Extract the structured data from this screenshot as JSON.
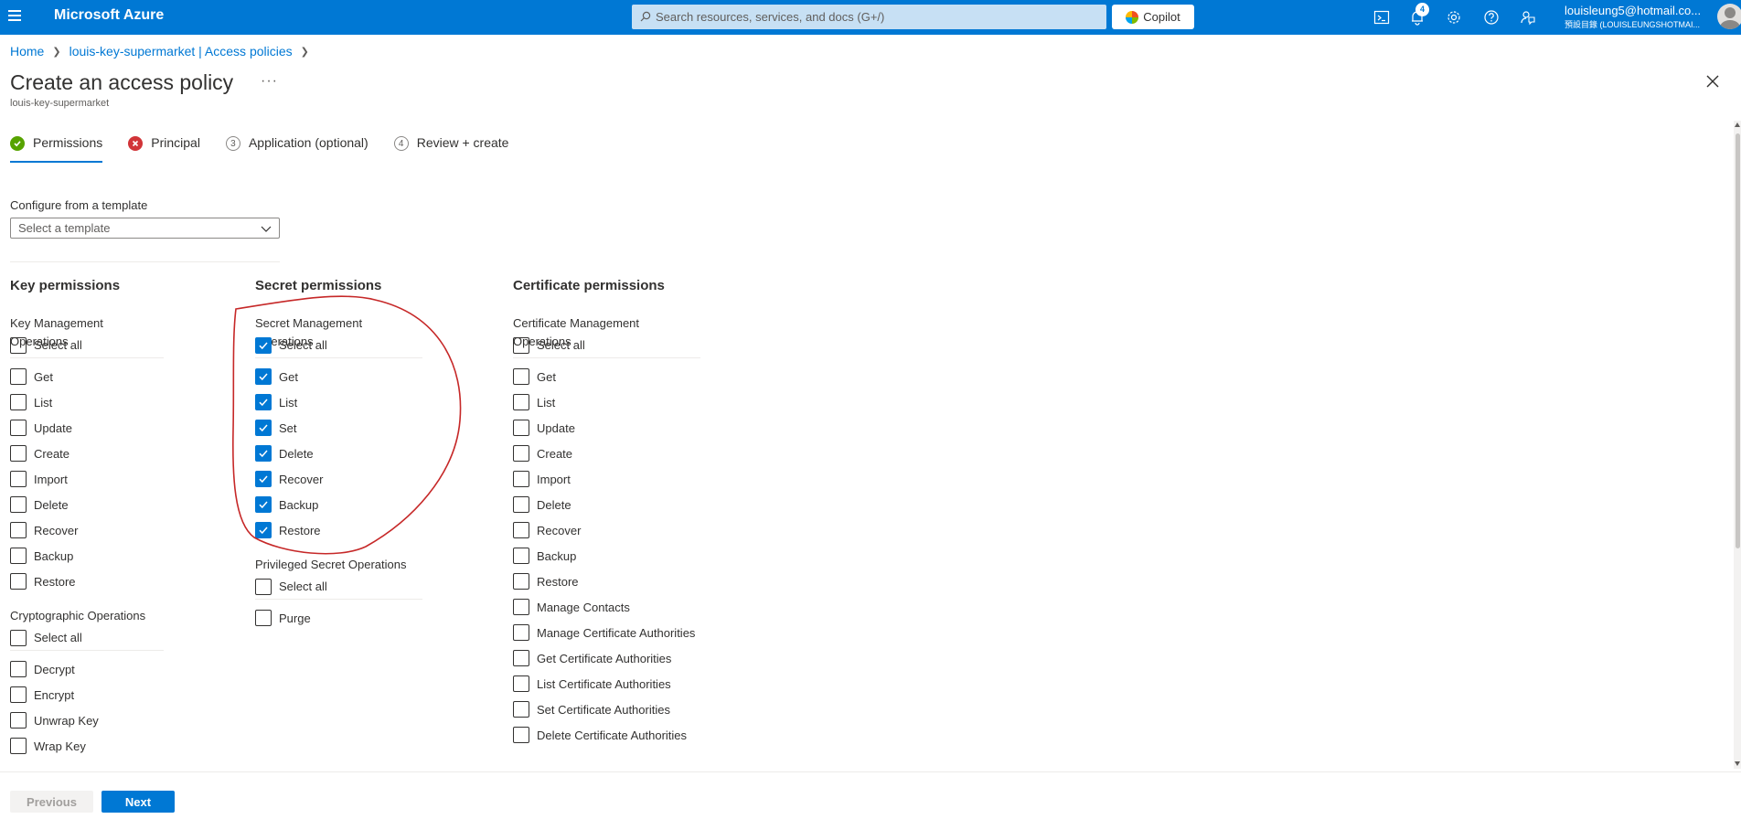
{
  "topbar": {
    "brand": "Microsoft Azure",
    "search_placeholder": "Search resources, services, and docs (G+/)",
    "copilot_label": "Copilot",
    "notification_count": "4",
    "account_email": "louisleung5@hotmail.co...",
    "account_directory": "預設目錄 (LOUISLEUNGSHOTMAI..."
  },
  "breadcrumb": {
    "home": "Home",
    "parent": "louis-key-supermarket | Access policies"
  },
  "page": {
    "title": "Create an access policy",
    "subtitle": "louis-key-supermarket",
    "more": "···"
  },
  "steps": [
    {
      "label": "Permissions",
      "state": "complete"
    },
    {
      "label": "Principal",
      "state": "error"
    },
    {
      "label": "Application (optional)",
      "number": "3"
    },
    {
      "label": "Review + create",
      "number": "4"
    }
  ],
  "template": {
    "label": "Configure from a template",
    "placeholder": "Select a template"
  },
  "key_permissions": {
    "title": "Key permissions",
    "management": {
      "title": "Key Management Operations",
      "select_all": "Select all",
      "items": [
        "Get",
        "List",
        "Update",
        "Create",
        "Import",
        "Delete",
        "Recover",
        "Backup",
        "Restore"
      ]
    },
    "crypto": {
      "title": "Cryptographic Operations",
      "select_all": "Select all",
      "items": [
        "Decrypt",
        "Encrypt",
        "Unwrap Key",
        "Wrap Key"
      ]
    }
  },
  "secret_permissions": {
    "title": "Secret permissions",
    "management": {
      "title": "Secret Management Operations",
      "select_all": "Select all",
      "select_all_checked": true,
      "items": [
        "Get",
        "List",
        "Set",
        "Delete",
        "Recover",
        "Backup",
        "Restore"
      ],
      "checked": true
    },
    "privileged": {
      "title": "Privileged Secret Operations",
      "select_all": "Select all",
      "items": [
        "Purge"
      ]
    }
  },
  "certificate_permissions": {
    "title": "Certificate permissions",
    "management": {
      "title": "Certificate Management Operations",
      "select_all": "Select all",
      "items": [
        "Get",
        "List",
        "Update",
        "Create",
        "Import",
        "Delete",
        "Recover",
        "Backup",
        "Restore",
        "Manage Contacts",
        "Manage Certificate Authorities",
        "Get Certificate Authorities",
        "List Certificate Authorities",
        "Set Certificate Authorities",
        "Delete Certificate Authorities"
      ]
    }
  },
  "footer": {
    "previous": "Previous",
    "next": "Next"
  },
  "colors": {
    "accent": "#0078d4",
    "success": "#57a300",
    "error": "#d13438",
    "annotation": "#c62828"
  }
}
